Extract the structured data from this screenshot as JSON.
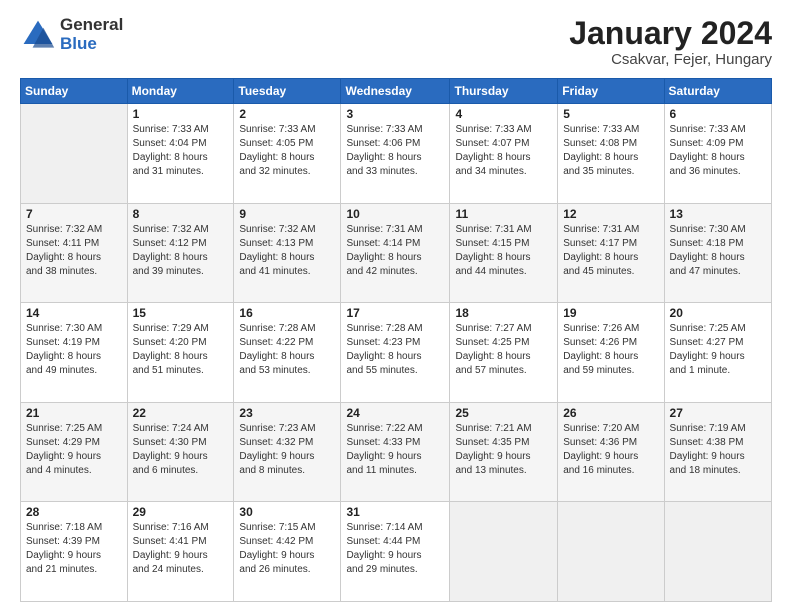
{
  "header": {
    "logo_general": "General",
    "logo_blue": "Blue",
    "main_title": "January 2024",
    "subtitle": "Csakvar, Fejer, Hungary"
  },
  "calendar": {
    "days_of_week": [
      "Sunday",
      "Monday",
      "Tuesday",
      "Wednesday",
      "Thursday",
      "Friday",
      "Saturday"
    ],
    "weeks": [
      [
        {
          "day": "",
          "info": ""
        },
        {
          "day": "1",
          "info": "Sunrise: 7:33 AM\nSunset: 4:04 PM\nDaylight: 8 hours\nand 31 minutes."
        },
        {
          "day": "2",
          "info": "Sunrise: 7:33 AM\nSunset: 4:05 PM\nDaylight: 8 hours\nand 32 minutes."
        },
        {
          "day": "3",
          "info": "Sunrise: 7:33 AM\nSunset: 4:06 PM\nDaylight: 8 hours\nand 33 minutes."
        },
        {
          "day": "4",
          "info": "Sunrise: 7:33 AM\nSunset: 4:07 PM\nDaylight: 8 hours\nand 34 minutes."
        },
        {
          "day": "5",
          "info": "Sunrise: 7:33 AM\nSunset: 4:08 PM\nDaylight: 8 hours\nand 35 minutes."
        },
        {
          "day": "6",
          "info": "Sunrise: 7:33 AM\nSunset: 4:09 PM\nDaylight: 8 hours\nand 36 minutes."
        }
      ],
      [
        {
          "day": "7",
          "info": "Sunrise: 7:32 AM\nSunset: 4:11 PM\nDaylight: 8 hours\nand 38 minutes."
        },
        {
          "day": "8",
          "info": "Sunrise: 7:32 AM\nSunset: 4:12 PM\nDaylight: 8 hours\nand 39 minutes."
        },
        {
          "day": "9",
          "info": "Sunrise: 7:32 AM\nSunset: 4:13 PM\nDaylight: 8 hours\nand 41 minutes."
        },
        {
          "day": "10",
          "info": "Sunrise: 7:31 AM\nSunset: 4:14 PM\nDaylight: 8 hours\nand 42 minutes."
        },
        {
          "day": "11",
          "info": "Sunrise: 7:31 AM\nSunset: 4:15 PM\nDaylight: 8 hours\nand 44 minutes."
        },
        {
          "day": "12",
          "info": "Sunrise: 7:31 AM\nSunset: 4:17 PM\nDaylight: 8 hours\nand 45 minutes."
        },
        {
          "day": "13",
          "info": "Sunrise: 7:30 AM\nSunset: 4:18 PM\nDaylight: 8 hours\nand 47 minutes."
        }
      ],
      [
        {
          "day": "14",
          "info": "Sunrise: 7:30 AM\nSunset: 4:19 PM\nDaylight: 8 hours\nand 49 minutes."
        },
        {
          "day": "15",
          "info": "Sunrise: 7:29 AM\nSunset: 4:20 PM\nDaylight: 8 hours\nand 51 minutes."
        },
        {
          "day": "16",
          "info": "Sunrise: 7:28 AM\nSunset: 4:22 PM\nDaylight: 8 hours\nand 53 minutes."
        },
        {
          "day": "17",
          "info": "Sunrise: 7:28 AM\nSunset: 4:23 PM\nDaylight: 8 hours\nand 55 minutes."
        },
        {
          "day": "18",
          "info": "Sunrise: 7:27 AM\nSunset: 4:25 PM\nDaylight: 8 hours\nand 57 minutes."
        },
        {
          "day": "19",
          "info": "Sunrise: 7:26 AM\nSunset: 4:26 PM\nDaylight: 8 hours\nand 59 minutes."
        },
        {
          "day": "20",
          "info": "Sunrise: 7:25 AM\nSunset: 4:27 PM\nDaylight: 9 hours\nand 1 minute."
        }
      ],
      [
        {
          "day": "21",
          "info": "Sunrise: 7:25 AM\nSunset: 4:29 PM\nDaylight: 9 hours\nand 4 minutes."
        },
        {
          "day": "22",
          "info": "Sunrise: 7:24 AM\nSunset: 4:30 PM\nDaylight: 9 hours\nand 6 minutes."
        },
        {
          "day": "23",
          "info": "Sunrise: 7:23 AM\nSunset: 4:32 PM\nDaylight: 9 hours\nand 8 minutes."
        },
        {
          "day": "24",
          "info": "Sunrise: 7:22 AM\nSunset: 4:33 PM\nDaylight: 9 hours\nand 11 minutes."
        },
        {
          "day": "25",
          "info": "Sunrise: 7:21 AM\nSunset: 4:35 PM\nDaylight: 9 hours\nand 13 minutes."
        },
        {
          "day": "26",
          "info": "Sunrise: 7:20 AM\nSunset: 4:36 PM\nDaylight: 9 hours\nand 16 minutes."
        },
        {
          "day": "27",
          "info": "Sunrise: 7:19 AM\nSunset: 4:38 PM\nDaylight: 9 hours\nand 18 minutes."
        }
      ],
      [
        {
          "day": "28",
          "info": "Sunrise: 7:18 AM\nSunset: 4:39 PM\nDaylight: 9 hours\nand 21 minutes."
        },
        {
          "day": "29",
          "info": "Sunrise: 7:16 AM\nSunset: 4:41 PM\nDaylight: 9 hours\nand 24 minutes."
        },
        {
          "day": "30",
          "info": "Sunrise: 7:15 AM\nSunset: 4:42 PM\nDaylight: 9 hours\nand 26 minutes."
        },
        {
          "day": "31",
          "info": "Sunrise: 7:14 AM\nSunset: 4:44 PM\nDaylight: 9 hours\nand 29 minutes."
        },
        {
          "day": "",
          "info": ""
        },
        {
          "day": "",
          "info": ""
        },
        {
          "day": "",
          "info": ""
        }
      ]
    ]
  }
}
